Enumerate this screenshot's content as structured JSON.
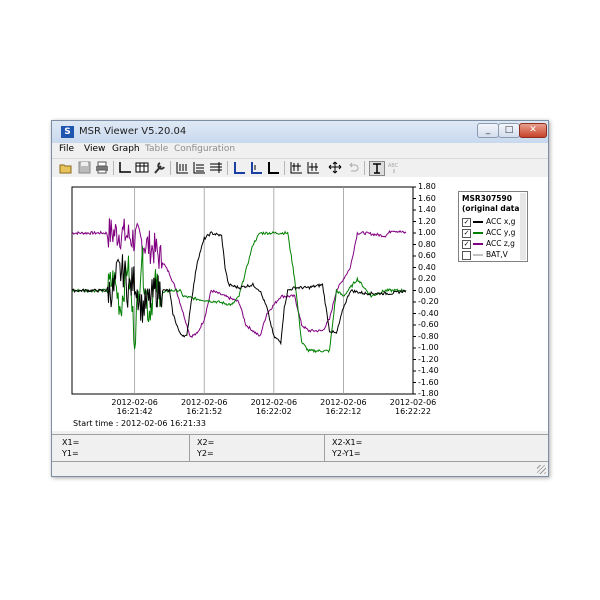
{
  "window": {
    "title": "MSR Viewer V5.20.04",
    "app_icon": "S"
  },
  "menu": [
    {
      "label": "File",
      "enabled": true
    },
    {
      "label": "View",
      "enabled": true
    },
    {
      "label": "Graph",
      "enabled": true
    },
    {
      "label": "Table",
      "enabled": false
    },
    {
      "label": "Configuration",
      "enabled": false
    }
  ],
  "toolbar_icons": [
    "open-icon",
    "save-icon",
    "print-icon",
    "axis-icon",
    "table-icon",
    "wrench-icon",
    "scale-x-icon",
    "scale-y-icon",
    "grid-icon",
    "axis-blue-icon",
    "axis-blue-2-icon",
    "axis-black-icon",
    "zoom-in-icon",
    "zoom-out-icon",
    "move-icon",
    "undo-icon",
    "text-icon",
    "text-small-icon"
  ],
  "chart_data": {
    "type": "line",
    "ylim": [
      -1.8,
      1.8
    ],
    "y_ticks": [
      "1.80",
      "1.60",
      "1.40",
      "1.20",
      "1.00",
      "0.80",
      "0.60",
      "0.40",
      "0.20",
      "0.00",
      "-0.20",
      "-0.40",
      "-0.60",
      "-0.80",
      "-1.00",
      "-1.20",
      "-1.40",
      "-1.60",
      "-1.80"
    ],
    "x_ticks": [
      {
        "date": "2012-02-06",
        "time": "16:21:42"
      },
      {
        "date": "2012-02-06",
        "time": "16:21:52"
      },
      {
        "date": "2012-02-06",
        "time": "16:22:02"
      },
      {
        "date": "2012-02-06",
        "time": "16:22:12"
      },
      {
        "date": "2012-02-06",
        "time": "16:22:22"
      }
    ],
    "x_range_s": [
      0,
      49
    ],
    "grid": "vertical",
    "legend": "top-right",
    "series": [
      {
        "name": "ACC x,g",
        "color": "#000000",
        "checked": true,
        "points": [
          [
            0,
            0.0
          ],
          [
            6,
            0.0
          ],
          [
            6.5,
            0.3
          ],
          [
            7.5,
            0.35
          ],
          [
            8,
            0.0
          ],
          [
            9,
            0.2
          ],
          [
            10,
            -0.3
          ],
          [
            11,
            -0.2
          ],
          [
            12,
            0.0
          ],
          [
            14,
            0.0
          ],
          [
            14.5,
            -0.4
          ],
          [
            15.5,
            -0.75
          ],
          [
            16.5,
            -0.8
          ],
          [
            17,
            -0.3
          ],
          [
            18,
            0.5
          ],
          [
            19,
            0.9
          ],
          [
            20,
            1.0
          ],
          [
            21.5,
            0.95
          ],
          [
            22,
            0.4
          ],
          [
            22.5,
            0.1
          ],
          [
            24,
            0.05
          ],
          [
            26,
            0.1
          ],
          [
            27,
            0.0
          ],
          [
            28,
            -0.3
          ],
          [
            29,
            -0.8
          ],
          [
            30,
            -0.9
          ],
          [
            30.5,
            -0.3
          ],
          [
            31,
            0.0
          ],
          [
            32,
            0.05
          ],
          [
            34,
            0.05
          ],
          [
            36,
            0.1
          ],
          [
            37,
            -0.7
          ],
          [
            38,
            -0.75
          ],
          [
            39,
            -0.3
          ],
          [
            40,
            0.0
          ],
          [
            42,
            -0.05
          ],
          [
            46,
            -0.05
          ],
          [
            48,
            0.0
          ]
        ]
      },
      {
        "name": "ACC y,g",
        "color": "#008000",
        "checked": true,
        "points": [
          [
            0,
            0.0
          ],
          [
            5,
            0.0
          ],
          [
            6,
            0.2
          ],
          [
            7,
            -0.3
          ],
          [
            8,
            0.5
          ],
          [
            9,
            -0.8
          ],
          [
            10,
            0.6
          ],
          [
            11,
            -0.4
          ],
          [
            12,
            0.1
          ],
          [
            13,
            -0.05
          ],
          [
            14,
            0.0
          ],
          [
            15.5,
            0.0
          ],
          [
            16,
            -0.1
          ],
          [
            18,
            -0.15
          ],
          [
            21,
            -0.2
          ],
          [
            23,
            -0.25
          ],
          [
            24,
            -0.1
          ],
          [
            26,
            0.8
          ],
          [
            27,
            1.0
          ],
          [
            31,
            1.0
          ],
          [
            32,
            0.2
          ],
          [
            33,
            -0.9
          ],
          [
            34,
            -1.05
          ],
          [
            37,
            -1.05
          ],
          [
            38,
            0.0
          ],
          [
            39,
            -0.1
          ],
          [
            41,
            0.2
          ],
          [
            43,
            -0.1
          ],
          [
            45,
            0.0
          ],
          [
            48,
            0.0
          ]
        ]
      },
      {
        "name": "ACC z,g",
        "color": "#800080",
        "checked": true,
        "points": [
          [
            0,
            1.0
          ],
          [
            7,
            1.0
          ],
          [
            8,
            0.95
          ],
          [
            10,
            0.85
          ],
          [
            12,
            0.7
          ],
          [
            14,
            0.3
          ],
          [
            15,
            0.0
          ],
          [
            16,
            -0.4
          ],
          [
            17,
            -0.8
          ],
          [
            18,
            -0.75
          ],
          [
            19,
            -0.5
          ],
          [
            20,
            0.0
          ],
          [
            22,
            -0.1
          ],
          [
            24,
            -0.2
          ],
          [
            25,
            -0.6
          ],
          [
            26,
            -0.7
          ],
          [
            27,
            -0.8
          ],
          [
            28,
            -0.4
          ],
          [
            30,
            -0.1
          ],
          [
            32,
            -0.1
          ],
          [
            33,
            -0.6
          ],
          [
            34,
            -0.7
          ],
          [
            36,
            -0.7
          ],
          [
            37,
            -0.5
          ],
          [
            38,
            0.0
          ],
          [
            40,
            0.4
          ],
          [
            41,
            1.0
          ],
          [
            42,
            1.0
          ],
          [
            45,
            0.95
          ],
          [
            46,
            1.05
          ],
          [
            48,
            1.0
          ]
        ]
      },
      {
        "name": "BAT,V",
        "color": "#c0c0c0",
        "checked": false,
        "points": []
      }
    ]
  },
  "legend": {
    "title1": "MSR307590",
    "title2": "(original data)"
  },
  "start_time": "Start time : 2012-02-06 16:21:33",
  "cursor": {
    "x1": "X1=",
    "y1": "Y1=",
    "x2": "X2=",
    "y2": "Y2=",
    "dx": "X2-X1=",
    "dy": "Y2-Y1="
  }
}
